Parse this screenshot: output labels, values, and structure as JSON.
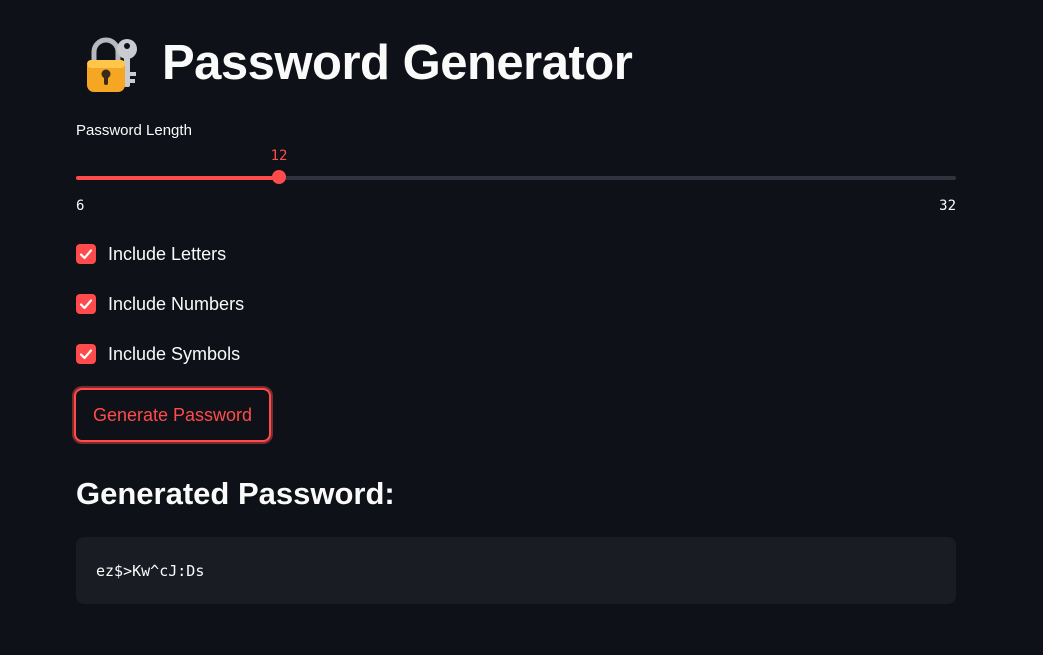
{
  "header": {
    "title": "Password Generator",
    "icon": "locked-with-key-icon"
  },
  "slider": {
    "label": "Password Length",
    "value": 12,
    "min": 6,
    "max": 32,
    "accent_color": "#ff4b4b"
  },
  "options": [
    {
      "label": "Include Letters",
      "checked": true
    },
    {
      "label": "Include Numbers",
      "checked": true
    },
    {
      "label": "Include Symbols",
      "checked": true
    }
  ],
  "generate_button": {
    "label": "Generate Password"
  },
  "result": {
    "heading": "Generated Password:",
    "password": "ez$>Kw^cJ:Ds"
  }
}
